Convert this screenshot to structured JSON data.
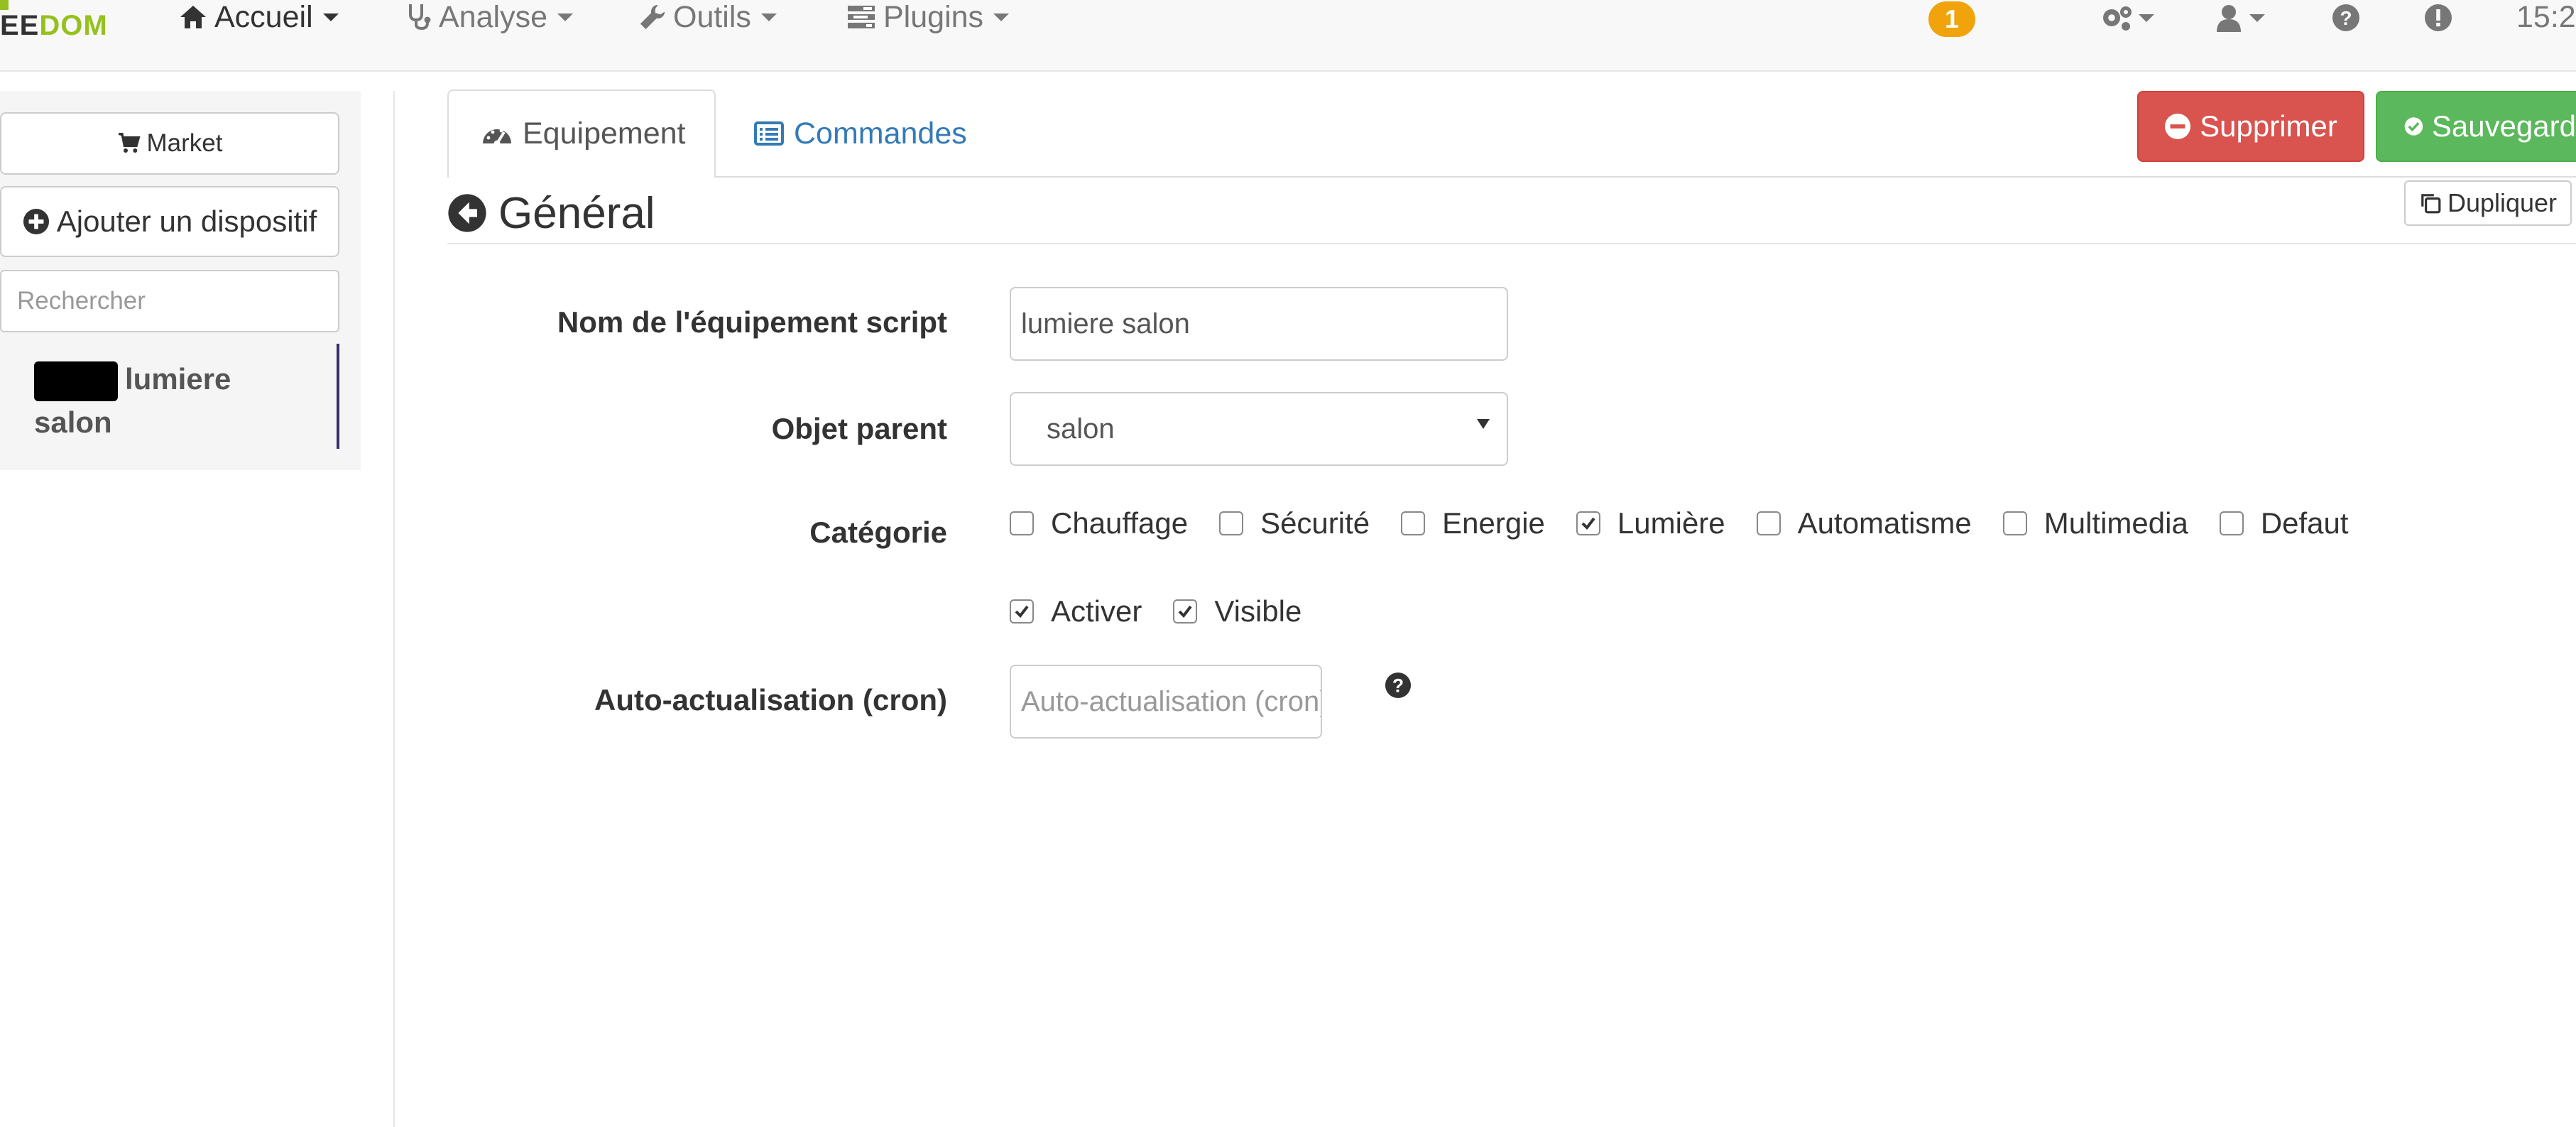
{
  "navbar": {
    "logo_left": "EE",
    "logo_right": "DOM",
    "items": [
      {
        "label": "Accueil",
        "icon": "home-icon"
      },
      {
        "label": "Analyse",
        "icon": "stethoscope-icon"
      },
      {
        "label": "Outils",
        "icon": "wrench-icon"
      },
      {
        "label": "Plugins",
        "icon": "tasks-icon"
      }
    ],
    "badge": "1",
    "clock": "15:2"
  },
  "sidebar": {
    "market_label": "Market",
    "add_label": "Ajouter un dispositif",
    "search_placeholder": "Rechercher",
    "items": [
      {
        "label_line1": "lumiere",
        "label_line2": "salon"
      }
    ]
  },
  "tabs": [
    {
      "label": "Equipement",
      "icon": "tachometer-icon",
      "active": true
    },
    {
      "label": "Commandes",
      "icon": "list-icon",
      "active": false
    }
  ],
  "actions": {
    "delete_label": "Supprimer",
    "save_label": "Sauvegard",
    "duplicate_label": "Dupliquer"
  },
  "form": {
    "legend": "Général",
    "name": {
      "label": "Nom de l'équipement script",
      "value": "lumiere salon"
    },
    "parent": {
      "label": "Objet parent",
      "value": "salon"
    },
    "category": {
      "label": "Catégorie",
      "options": [
        {
          "label": "Chauffage",
          "checked": false
        },
        {
          "label": "Sécurité",
          "checked": false
        },
        {
          "label": "Energie",
          "checked": false
        },
        {
          "label": "Lumière",
          "checked": true
        },
        {
          "label": "Automatisme",
          "checked": false
        },
        {
          "label": "Multimedia",
          "checked": false
        },
        {
          "label": "Defaut",
          "checked": false
        }
      ]
    },
    "flags": [
      {
        "label": "Activer",
        "checked": true
      },
      {
        "label": "Visible",
        "checked": true
      }
    ],
    "cron": {
      "label": "Auto-actualisation (cron)",
      "placeholder": "Auto-actualisation (cron)"
    }
  },
  "colors": {
    "danger": "#d9534f",
    "success": "#5cb85c",
    "link": "#337ab7",
    "brand": "#94c11f",
    "badge": "#f0a30a"
  }
}
